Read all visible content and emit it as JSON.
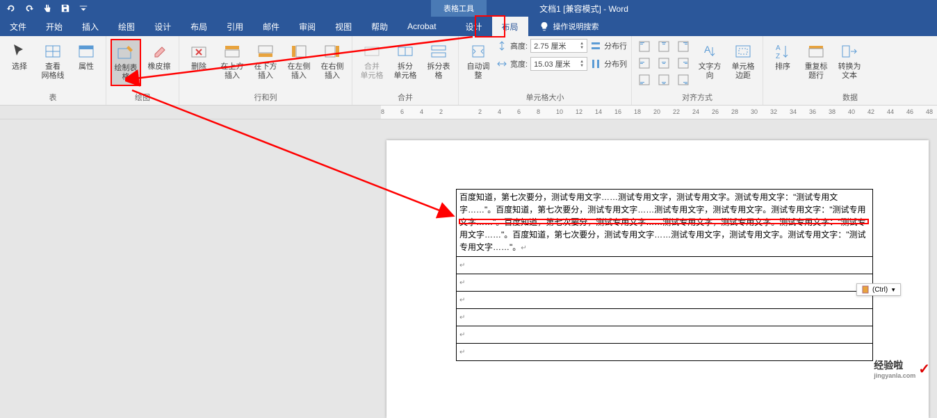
{
  "titlebar": {
    "context_tab": "表格工具",
    "title": "文档1 [兼容模式] - Word"
  },
  "tabs": {
    "file": "文件",
    "home": "开始",
    "insert": "插入",
    "draw": "绘图",
    "design": "设计",
    "layout": "布局",
    "references": "引用",
    "mailings": "邮件",
    "review": "审阅",
    "view": "视图",
    "help": "帮助",
    "acrobat": "Acrobat",
    "table_design": "设计",
    "table_layout": "布局",
    "tellme": "操作说明搜索"
  },
  "ribbon": {
    "groups": {
      "table": "表",
      "draw": "绘图",
      "rows_cols": "行和列",
      "merge": "合并",
      "cell_size": "单元格大小",
      "alignment": "对齐方式",
      "data": "数据"
    },
    "buttons": {
      "select": "选择",
      "view_gridlines": "查看\n网格线",
      "properties": "属性",
      "draw_table": "绘制表格",
      "eraser": "橡皮擦",
      "delete": "删除",
      "insert_above": "在上方插入",
      "insert_below": "在下方插入",
      "insert_left": "在左侧插入",
      "insert_right": "在右侧插入",
      "merge_cells": "合并\n单元格",
      "split_cells": "拆分\n单元格",
      "split_table": "拆分表格",
      "autofit": "自动调整",
      "height_label": "高度:",
      "width_label": "宽度:",
      "height_value": "2.75 厘米",
      "width_value": "15.03 厘米",
      "distribute_rows": "分布行",
      "distribute_cols": "分布列",
      "text_direction": "文字方向",
      "cell_margins": "单元格\n边距",
      "sort": "排序",
      "repeat_header": "重复标题行",
      "convert_text": "转换为文本"
    }
  },
  "ruler": {
    "ticks": [
      "8",
      "6",
      "4",
      "2",
      "",
      "2",
      "4",
      "6",
      "8",
      "10",
      "12",
      "14",
      "16",
      "18",
      "20",
      "22",
      "24",
      "26",
      "28",
      "30",
      "32",
      "34",
      "36",
      "38",
      "40",
      "42",
      "44",
      "46",
      "48"
    ]
  },
  "document": {
    "paragraph": "百度知道，第七次要分，测试专用文字……测试专用文字，测试专用文字。测试专用文字：\"测试专用文字……\"。百度知道，第七次要分，测试专用文字……测试专用文字，测试专用文字。测试专用文字：\"测试专用文字……\"。百度知道，第七次要分，测试专用文字……测试专用文字，测试专用文字。测试专用文字：\"测试专用文字……\"。百度知道，第七次要分，测试专用文字……测试专用文字，测试专用文字。测试专用文字：\"测试专用文字……\"。",
    "first_line": "百度知道，第七次要分，测试专用文字……测试专用文字，测试专用文字。测试专用文字：",
    "empty_rows": 6
  },
  "paste_options": {
    "label": "(Ctrl)"
  },
  "watermark": {
    "text": "经验啦",
    "domain": "jingyanla.com"
  }
}
